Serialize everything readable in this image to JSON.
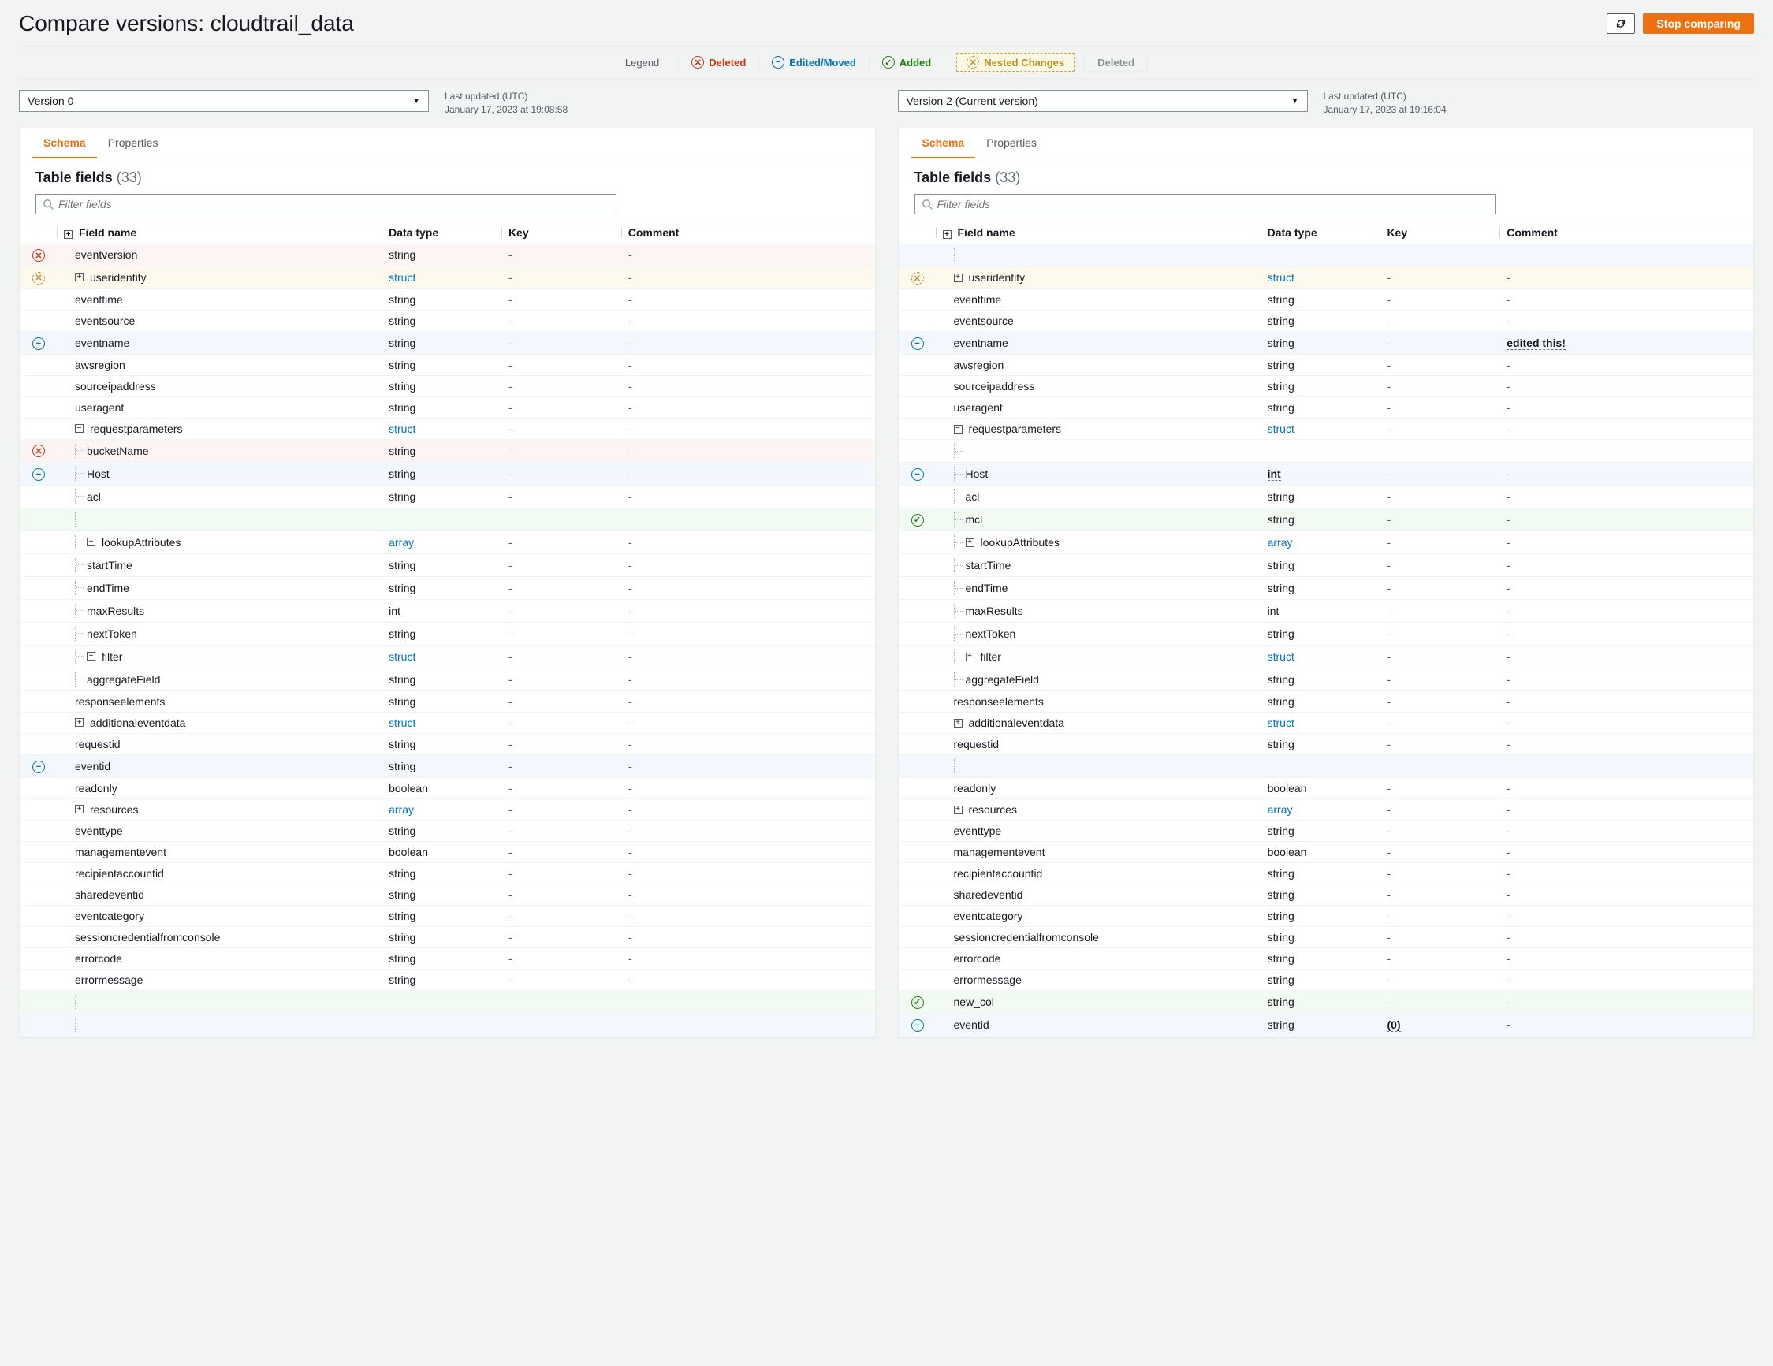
{
  "title": "Compare versions: cloudtrail_data",
  "stop_button": "Stop comparing",
  "legend": {
    "label": "Legend",
    "deleted": "Deleted",
    "edited": "Edited/Moved",
    "added": "Added",
    "nested": "Nested Changes",
    "muted_deleted": "Deleted"
  },
  "tabs": {
    "schema": "Schema",
    "properties": "Properties"
  },
  "meta": {
    "updated": "Last updated (UTC)"
  },
  "table_fields_label": "Table fields",
  "filter_placeholder": "Filter fields",
  "cols": {
    "name": "Field name",
    "type": "Data type",
    "key": "Key",
    "comment": "Comment"
  },
  "left": {
    "version": "Version 0",
    "timestamp": "January 17, 2023 at 19:08:58",
    "count": "(33)",
    "rows": [
      {
        "status": "deleted",
        "indent": 0,
        "exp": null,
        "name": "eventversion",
        "type": "string",
        "key": "-",
        "comment": "-"
      },
      {
        "status": "nested",
        "indent": 0,
        "exp": "+",
        "name": "useridentity",
        "type": "struct",
        "typelink": true,
        "key": "-",
        "comment": "-"
      },
      {
        "status": "",
        "indent": 0,
        "exp": null,
        "name": "eventtime",
        "type": "string",
        "key": "-",
        "comment": "-"
      },
      {
        "status": "",
        "indent": 0,
        "exp": null,
        "name": "eventsource",
        "type": "string",
        "key": "-",
        "comment": "-"
      },
      {
        "status": "edited",
        "indent": 0,
        "exp": null,
        "name": "eventname",
        "type": "string",
        "key": "-",
        "comment": "-"
      },
      {
        "status": "",
        "indent": 0,
        "exp": null,
        "name": "awsregion",
        "type": "string",
        "key": "-",
        "comment": "-"
      },
      {
        "status": "",
        "indent": 0,
        "exp": null,
        "name": "sourceipaddress",
        "type": "string",
        "key": "-",
        "comment": "-"
      },
      {
        "status": "",
        "indent": 0,
        "exp": null,
        "name": "useragent",
        "type": "string",
        "key": "-",
        "comment": "-"
      },
      {
        "status": "",
        "indent": 0,
        "exp": "-",
        "name": "requestparameters",
        "type": "struct",
        "typelink": true,
        "key": "-",
        "comment": "-"
      },
      {
        "status": "deleted",
        "indent": 1,
        "exp": null,
        "name": "bucketName",
        "type": "string",
        "key": "-",
        "comment": "-"
      },
      {
        "status": "edited",
        "indent": 1,
        "exp": null,
        "name": "Host",
        "type": "string",
        "key": "-",
        "comment": "-"
      },
      {
        "status": "",
        "indent": 1,
        "exp": null,
        "name": "acl",
        "type": "string",
        "key": "-",
        "comment": "-"
      },
      {
        "status": "blank-green"
      },
      {
        "status": "",
        "indent": 1,
        "exp": "+",
        "name": "lookupAttributes",
        "type": "array",
        "typelink": true,
        "key": "-",
        "comment": "-"
      },
      {
        "status": "",
        "indent": 1,
        "exp": null,
        "name": "startTime",
        "type": "string",
        "key": "-",
        "comment": "-"
      },
      {
        "status": "",
        "indent": 1,
        "exp": null,
        "name": "endTime",
        "type": "string",
        "key": "-",
        "comment": "-"
      },
      {
        "status": "",
        "indent": 1,
        "exp": null,
        "name": "maxResults",
        "type": "int",
        "key": "-",
        "comment": "-"
      },
      {
        "status": "",
        "indent": 1,
        "exp": null,
        "name": "nextToken",
        "type": "string",
        "key": "-",
        "comment": "-"
      },
      {
        "status": "",
        "indent": 1,
        "exp": "+",
        "name": "filter",
        "type": "struct",
        "typelink": true,
        "key": "-",
        "comment": "-"
      },
      {
        "status": "",
        "indent": 1,
        "exp": null,
        "name": "aggregateField",
        "type": "string",
        "key": "-",
        "comment": "-"
      },
      {
        "status": "",
        "indent": 0,
        "exp": null,
        "name": "responseelements",
        "type": "string",
        "key": "-",
        "comment": "-"
      },
      {
        "status": "",
        "indent": 0,
        "exp": "+",
        "name": "additionaleventdata",
        "type": "struct",
        "typelink": true,
        "key": "-",
        "comment": "-"
      },
      {
        "status": "",
        "indent": 0,
        "exp": null,
        "name": "requestid",
        "type": "string",
        "key": "-",
        "comment": "-"
      },
      {
        "status": "edited",
        "indent": 0,
        "exp": null,
        "name": "eventid",
        "type": "string",
        "key": "-",
        "comment": "-"
      },
      {
        "status": "",
        "indent": 0,
        "exp": null,
        "name": "readonly",
        "type": "boolean",
        "key": "-",
        "comment": "-"
      },
      {
        "status": "",
        "indent": 0,
        "exp": "+",
        "name": "resources",
        "type": "array",
        "typelink": true,
        "key": "-",
        "comment": "-"
      },
      {
        "status": "",
        "indent": 0,
        "exp": null,
        "name": "eventtype",
        "type": "string",
        "key": "-",
        "comment": "-"
      },
      {
        "status": "",
        "indent": 0,
        "exp": null,
        "name": "managementevent",
        "type": "boolean",
        "key": "-",
        "comment": "-"
      },
      {
        "status": "",
        "indent": 0,
        "exp": null,
        "name": "recipientaccountid",
        "type": "string",
        "key": "-",
        "comment": "-"
      },
      {
        "status": "",
        "indent": 0,
        "exp": null,
        "name": "sharedeventid",
        "type": "string",
        "key": "-",
        "comment": "-"
      },
      {
        "status": "",
        "indent": 0,
        "exp": null,
        "name": "eventcategory",
        "type": "string",
        "key": "-",
        "comment": "-"
      },
      {
        "status": "",
        "indent": 0,
        "exp": null,
        "name": "sessioncredentialfromconsole",
        "type": "string",
        "key": "-",
        "comment": "-"
      },
      {
        "status": "",
        "indent": 0,
        "exp": null,
        "name": "errorcode",
        "type": "string",
        "key": "-",
        "comment": "-"
      },
      {
        "status": "",
        "indent": 0,
        "exp": null,
        "name": "errormessage",
        "type": "string",
        "key": "-",
        "comment": "-"
      },
      {
        "status": "blank-green"
      },
      {
        "status": "blank-blue"
      }
    ]
  },
  "right": {
    "version": "Version 2 (Current version)",
    "timestamp": "January 17, 2023 at 19:16:04",
    "count": "(33)",
    "rows": [
      {
        "status": "blank-blue"
      },
      {
        "status": "nested",
        "indent": 0,
        "exp": "+",
        "name": "useridentity",
        "type": "struct",
        "typelink": true,
        "key": "-",
        "comment": "-"
      },
      {
        "status": "",
        "indent": 0,
        "exp": null,
        "name": "eventtime",
        "type": "string",
        "key": "-",
        "comment": "-"
      },
      {
        "status": "",
        "indent": 0,
        "exp": null,
        "name": "eventsource",
        "type": "string",
        "key": "-",
        "comment": "-"
      },
      {
        "status": "edited",
        "indent": 0,
        "exp": null,
        "name": "eventname",
        "type": "string",
        "key": "-",
        "comment": "edited this!",
        "comment_edited": true
      },
      {
        "status": "",
        "indent": 0,
        "exp": null,
        "name": "awsregion",
        "type": "string",
        "key": "-",
        "comment": "-"
      },
      {
        "status": "",
        "indent": 0,
        "exp": null,
        "name": "sourceipaddress",
        "type": "string",
        "key": "-",
        "comment": "-"
      },
      {
        "status": "",
        "indent": 0,
        "exp": null,
        "name": "useragent",
        "type": "string",
        "key": "-",
        "comment": "-"
      },
      {
        "status": "",
        "indent": 0,
        "exp": "-",
        "name": "requestparameters",
        "type": "struct",
        "typelink": true,
        "key": "-",
        "comment": "-"
      },
      {
        "status": "",
        "indent": 1,
        "exp": null,
        "name": "",
        "type": "",
        "key": "",
        "comment": ""
      },
      {
        "status": "edited",
        "indent": 1,
        "exp": null,
        "name": "Host",
        "type": "int",
        "type_edited": true,
        "key": "-",
        "comment": "-"
      },
      {
        "status": "",
        "indent": 1,
        "exp": null,
        "name": "acl",
        "type": "string",
        "key": "-",
        "comment": "-"
      },
      {
        "status": "added",
        "indent": 1,
        "exp": null,
        "name": "mcl",
        "type": "string",
        "key": "-",
        "comment": "-"
      },
      {
        "status": "",
        "indent": 1,
        "exp": "+",
        "name": "lookupAttributes",
        "type": "array",
        "typelink": true,
        "key": "-",
        "comment": "-"
      },
      {
        "status": "",
        "indent": 1,
        "exp": null,
        "name": "startTime",
        "type": "string",
        "key": "-",
        "comment": "-"
      },
      {
        "status": "",
        "indent": 1,
        "exp": null,
        "name": "endTime",
        "type": "string",
        "key": "-",
        "comment": "-"
      },
      {
        "status": "",
        "indent": 1,
        "exp": null,
        "name": "maxResults",
        "type": "int",
        "key": "-",
        "comment": "-"
      },
      {
        "status": "",
        "indent": 1,
        "exp": null,
        "name": "nextToken",
        "type": "string",
        "key": "-",
        "comment": "-"
      },
      {
        "status": "",
        "indent": 1,
        "exp": "+",
        "name": "filter",
        "type": "struct",
        "typelink": true,
        "key": "-",
        "comment": "-"
      },
      {
        "status": "",
        "indent": 1,
        "exp": null,
        "name": "aggregateField",
        "type": "string",
        "key": "-",
        "comment": "-"
      },
      {
        "status": "",
        "indent": 0,
        "exp": null,
        "name": "responseelements",
        "type": "string",
        "key": "-",
        "comment": "-"
      },
      {
        "status": "",
        "indent": 0,
        "exp": "+",
        "name": "additionaleventdata",
        "type": "struct",
        "typelink": true,
        "key": "-",
        "comment": "-"
      },
      {
        "status": "",
        "indent": 0,
        "exp": null,
        "name": "requestid",
        "type": "string",
        "key": "-",
        "comment": "-"
      },
      {
        "status": "blank-blue"
      },
      {
        "status": "",
        "indent": 0,
        "exp": null,
        "name": "readonly",
        "type": "boolean",
        "key": "-",
        "comment": "-"
      },
      {
        "status": "",
        "indent": 0,
        "exp": "+",
        "name": "resources",
        "type": "array",
        "typelink": true,
        "key": "-",
        "comment": "-"
      },
      {
        "status": "",
        "indent": 0,
        "exp": null,
        "name": "eventtype",
        "type": "string",
        "key": "-",
        "comment": "-"
      },
      {
        "status": "",
        "indent": 0,
        "exp": null,
        "name": "managementevent",
        "type": "boolean",
        "key": "-",
        "comment": "-"
      },
      {
        "status": "",
        "indent": 0,
        "exp": null,
        "name": "recipientaccountid",
        "type": "string",
        "key": "-",
        "comment": "-"
      },
      {
        "status": "",
        "indent": 0,
        "exp": null,
        "name": "sharedeventid",
        "type": "string",
        "key": "-",
        "comment": "-"
      },
      {
        "status": "",
        "indent": 0,
        "exp": null,
        "name": "eventcategory",
        "type": "string",
        "key": "-",
        "comment": "-"
      },
      {
        "status": "",
        "indent": 0,
        "exp": null,
        "name": "sessioncredentialfromconsole",
        "type": "string",
        "key": "-",
        "comment": "-"
      },
      {
        "status": "",
        "indent": 0,
        "exp": null,
        "name": "errorcode",
        "type": "string",
        "key": "-",
        "comment": "-"
      },
      {
        "status": "",
        "indent": 0,
        "exp": null,
        "name": "errormessage",
        "type": "string",
        "key": "-",
        "comment": "-"
      },
      {
        "status": "added",
        "indent": 0,
        "exp": null,
        "name": "new_col",
        "type": "string",
        "key": "-",
        "comment": "-"
      },
      {
        "status": "edited",
        "indent": 0,
        "exp": null,
        "name": "eventid",
        "type": "string",
        "key": "(0)",
        "key_edited": true,
        "comment": "-"
      }
    ]
  }
}
